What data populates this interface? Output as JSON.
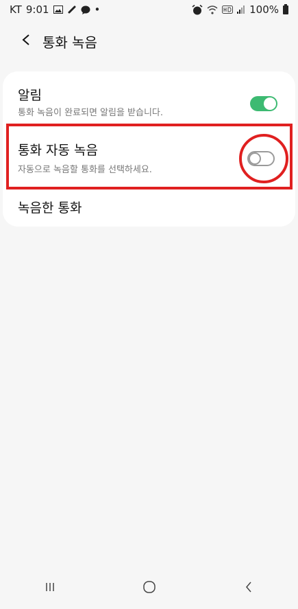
{
  "status_bar": {
    "carrier": "KT",
    "time": "9:01",
    "dot": "•",
    "battery_pct": "100%",
    "left_icons": [
      "gallery-icon",
      "link-icon",
      "chat-icon"
    ],
    "right_icons": [
      "alarm-icon",
      "wifi-icon",
      "hd-icon",
      "signal-icon",
      "battery-icon"
    ]
  },
  "header": {
    "title": "통화 녹음",
    "back_icon": "chevron-left-icon"
  },
  "settings": {
    "alarm": {
      "title": "알림",
      "description": "통화 녹음이 완료되면 알림을 받습니다.",
      "enabled": true
    },
    "auto_record": {
      "title": "통화 자동 녹음",
      "description": "자동으로 녹음할 통화를 선택하세요.",
      "enabled": false
    },
    "recorded_calls": {
      "title": "녹음한 통화"
    }
  },
  "colors": {
    "toggle_on": "#3dba72",
    "annotation": "#e02020",
    "background": "#f6f6f6"
  },
  "nav_bar": {
    "icons": [
      "recent-apps-icon",
      "home-icon",
      "back-icon"
    ]
  }
}
